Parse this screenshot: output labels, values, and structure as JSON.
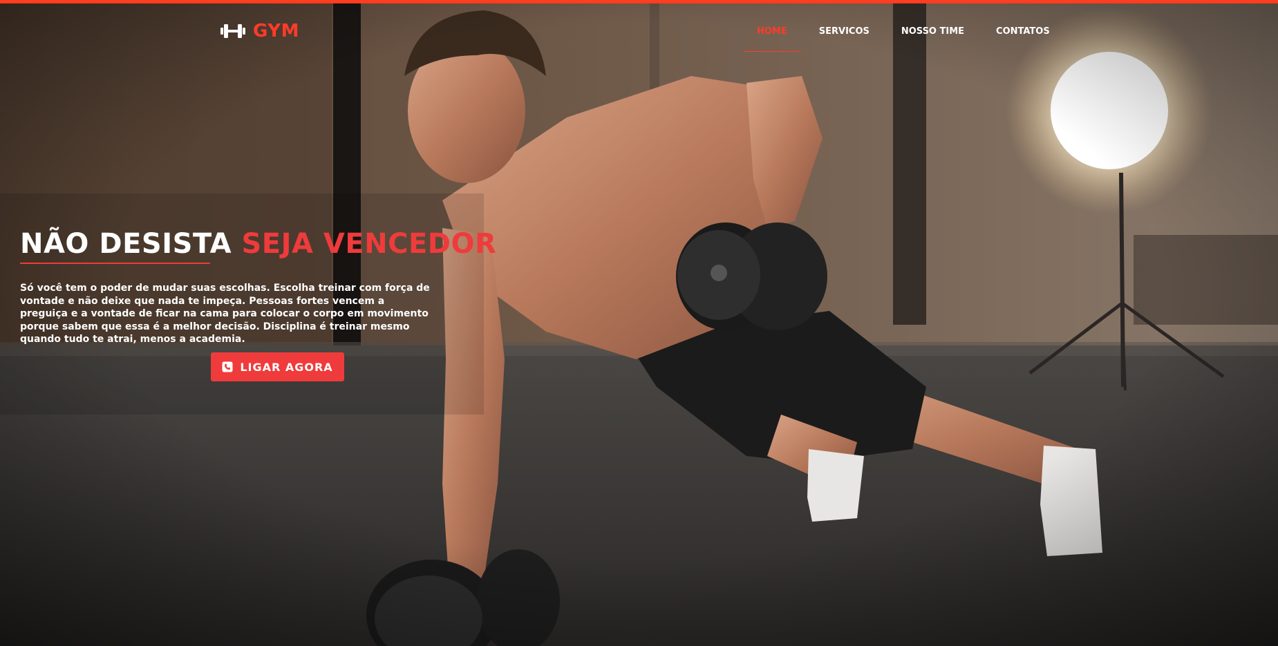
{
  "brand": {
    "name": "GYM",
    "icon": "dumbbell-icon",
    "color": "#ff3b2a"
  },
  "nav": {
    "items": [
      {
        "label": "HOME",
        "active": true
      },
      {
        "label": "SERVICOS",
        "active": false
      },
      {
        "label": "NOSSO TIME",
        "active": false
      },
      {
        "label": "CONTATOS",
        "active": false
      }
    ]
  },
  "hero": {
    "headline_white": "NÃO DESISTA",
    "headline_accent": "SEJA VENCEDOR",
    "description": "Só você tem o poder de mudar suas escolhas. Escolha treinar com força de vontade e não deixe que nada te impeça. Pessoas fortes vencem a preguiça e a vontade de ficar na cama para colocar o corpo em movimento porque sabem que essa é a melhor decisão. Disciplina é treinar mesmo quando tudo te atrai, menos a academia.",
    "cta_label": "LIGAR AGORA",
    "cta_icon": "phone-icon",
    "background_image": "man-doing-dumbbell-row-plank-photo"
  },
  "colors": {
    "accent": "#ef3b3b",
    "top_bar": "#ff3d1f",
    "text": "#ffffff"
  }
}
